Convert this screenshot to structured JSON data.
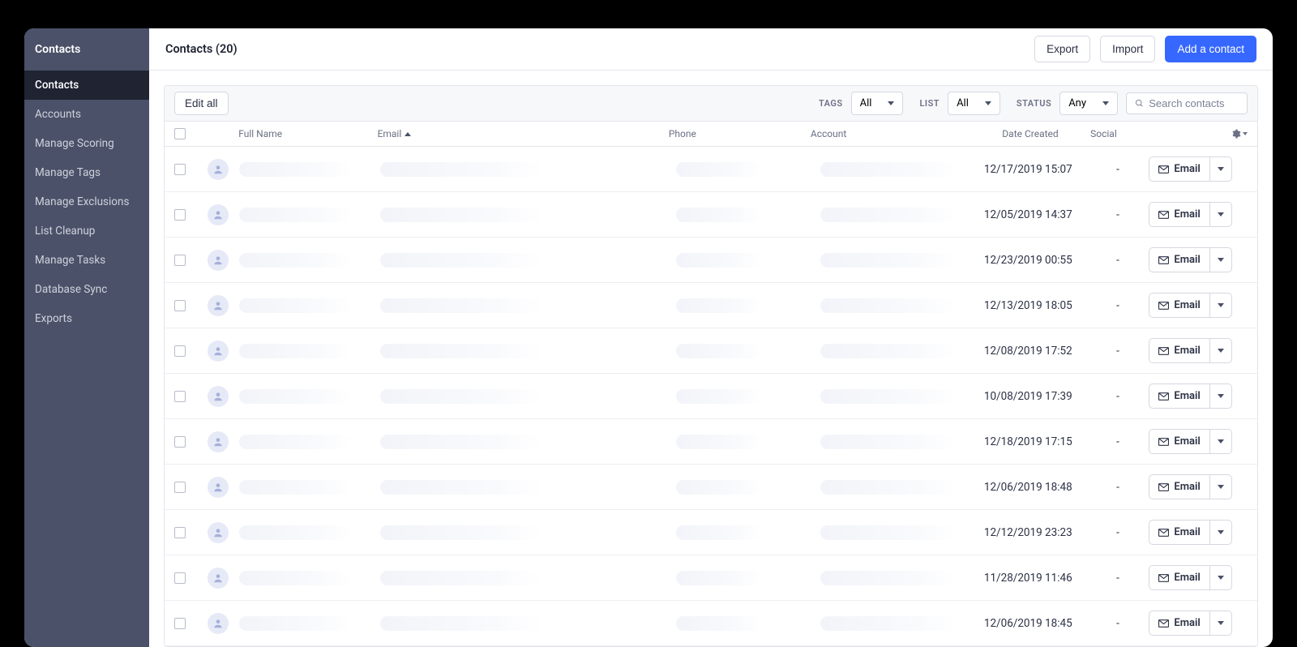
{
  "sidebar": {
    "title": "Contacts",
    "items": [
      {
        "label": "Contacts",
        "active": true
      },
      {
        "label": "Accounts",
        "active": false
      },
      {
        "label": "Manage Scoring",
        "active": false
      },
      {
        "label": "Manage Tags",
        "active": false
      },
      {
        "label": "Manage Exclusions",
        "active": false
      },
      {
        "label": "List Cleanup",
        "active": false
      },
      {
        "label": "Manage Tasks",
        "active": false
      },
      {
        "label": "Database Sync",
        "active": false
      },
      {
        "label": "Exports",
        "active": false
      }
    ]
  },
  "header": {
    "title": "Contacts (20)",
    "export_label": "Export",
    "import_label": "Import",
    "add_label": "Add a contact"
  },
  "filters": {
    "edit_all_label": "Edit all",
    "tags_label": "TAGS",
    "tags_value": "All",
    "list_label": "LIST",
    "list_value": "All",
    "status_label": "STATUS",
    "status_value": "Any",
    "search_placeholder": "Search contacts"
  },
  "columns": {
    "full_name": "Full Name",
    "email": "Email",
    "phone": "Phone",
    "account": "Account",
    "date_created": "Date Created",
    "social": "Social"
  },
  "row_action": {
    "email_label": "Email"
  },
  "rows": [
    {
      "date": "12/17/2019 15:07",
      "social": "-"
    },
    {
      "date": "12/05/2019 14:37",
      "social": "-"
    },
    {
      "date": "12/23/2019 00:55",
      "social": "-"
    },
    {
      "date": "12/13/2019 18:05",
      "social": "-"
    },
    {
      "date": "12/08/2019 17:52",
      "social": "-"
    },
    {
      "date": "10/08/2019 17:39",
      "social": "-"
    },
    {
      "date": "12/18/2019 17:15",
      "social": "-"
    },
    {
      "date": "12/06/2019 18:48",
      "social": "-"
    },
    {
      "date": "12/12/2019 23:23",
      "social": "-"
    },
    {
      "date": "11/28/2019 11:46",
      "social": "-"
    },
    {
      "date": "12/06/2019 18:45",
      "social": "-"
    }
  ]
}
